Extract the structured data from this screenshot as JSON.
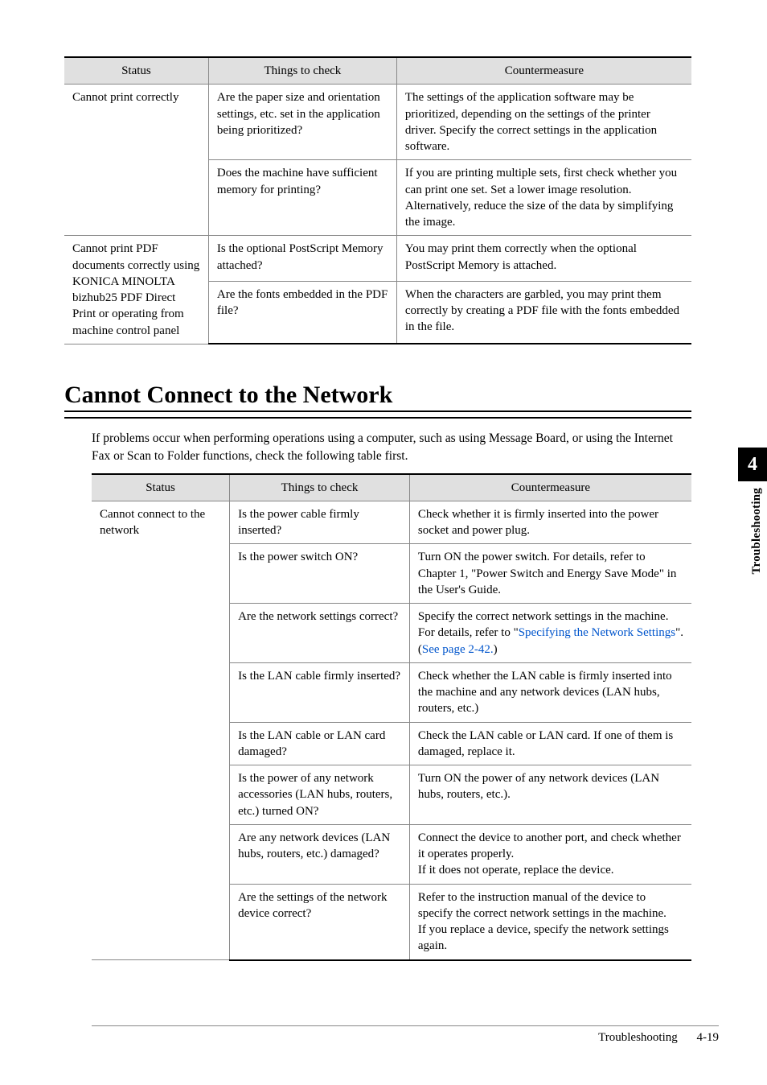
{
  "side": {
    "chapter": "4",
    "label": "Troubleshooting"
  },
  "table1": {
    "headers": [
      "Status",
      "Things to check",
      "Countermeasure"
    ],
    "rows": [
      {
        "status": "Cannot print correctly",
        "check": "Are the paper size and orientation settings, etc. set in the application being prioritized?",
        "counter": "The settings of the application software may be prioritized, depending on the settings of the printer driver. Specify the correct settings in the application software."
      },
      {
        "status": "",
        "check": "Does the machine have sufficient memory for printing?",
        "counter": "If you are printing multiple sets, first check whether you can print one set. Set a lower image resolution. Alternatively, reduce the size of the data by simplifying the image."
      },
      {
        "status": "Cannot print PDF documents correctly using KONICA MINOLTA bizhub25 PDF Direct Print or operating from machine control panel",
        "check": "Is the optional PostScript Memory attached?",
        "counter": "You may print them correctly when the optional PostScript Memory is attached."
      },
      {
        "status": "",
        "check": "Are the fonts embedded in the PDF file?",
        "counter": "When the characters are garbled, you may print them correctly by creating a PDF file with the fonts embedded in the file."
      }
    ]
  },
  "heading": "Cannot Connect to the Network",
  "intro": "If problems occur when performing operations using a computer, such as using Message Board, or using the Internet Fax or Scan to Folder functions, check the following table first.",
  "table2": {
    "headers": [
      "Status",
      "Things to check",
      "Countermeasure"
    ],
    "rows": [
      {
        "status": "Cannot connect to the network",
        "check": "Is the power cable firmly inserted?",
        "counter": "Check whether it is firmly inserted into the power socket and power plug."
      },
      {
        "status": "",
        "check": "Is the power switch ON?",
        "counter": "Turn ON the power switch. For details, refer to Chapter 1, \"Power Switch and Energy Save Mode\" in the User's Guide."
      },
      {
        "status": "",
        "check": "Are the network settings correct?",
        "counter_pre": "Specify the correct network settings in the machine. For details, refer to \"",
        "counter_link1": "Specifying the Network Settings",
        "counter_mid": "\". (",
        "counter_link2": "See page 2-42.",
        "counter_post": ")"
      },
      {
        "status": "",
        "check": "Is the LAN cable firmly inserted?",
        "counter": "Check whether the LAN cable is firmly inserted into the machine and any network devices (LAN hubs, routers, etc.)"
      },
      {
        "status": "",
        "check": "Is the LAN cable or LAN card damaged?",
        "counter": "Check the LAN cable or LAN card. If one of them is damaged, replace it."
      },
      {
        "status": "",
        "check": "Is the power of any network accessories (LAN hubs, routers, etc.) turned ON?",
        "counter": "Turn ON the power of any network devices (LAN hubs, routers, etc.)."
      },
      {
        "status": "",
        "check": "Are any network devices (LAN hubs, routers, etc.) damaged?",
        "counter": "Connect the device to another port, and check whether it operates properly.\nIf it does not operate, replace the device."
      },
      {
        "status": "",
        "check": "Are the settings of the network device correct?",
        "counter": "Refer to the instruction manual of the device to specify the correct network settings in the machine.\nIf you replace a device, specify the network settings again."
      }
    ]
  },
  "footer": {
    "title": "Troubleshooting",
    "page": "4-19"
  }
}
